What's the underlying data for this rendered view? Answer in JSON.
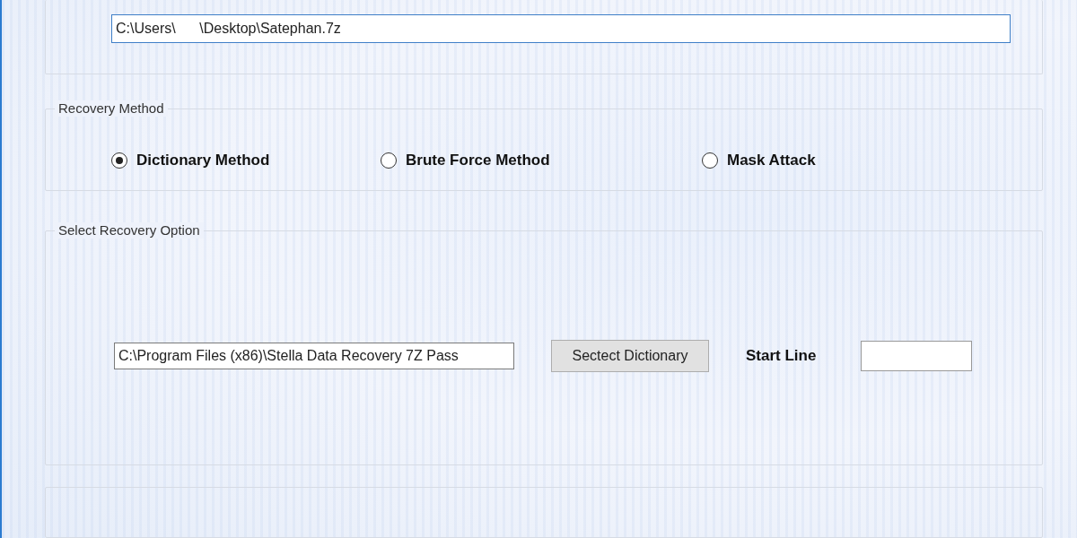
{
  "archive_path": {
    "value": "C:\\Users\\      \\Desktop\\Satephan.7z"
  },
  "recovery_method": {
    "title": "Recovery Method",
    "options": [
      {
        "label": "Dictionary Method",
        "selected": true
      },
      {
        "label": "Brute Force Method",
        "selected": false
      },
      {
        "label": "Mask Attack",
        "selected": false
      }
    ]
  },
  "recovery_option": {
    "title": "Select Recovery Option",
    "dictionary_path": {
      "value": "C:\\Program Files (x86)\\Stella Data Recovery 7Z Pass"
    },
    "select_button": "Sectect Dictionary",
    "start_line_label": "Start Line"
  }
}
